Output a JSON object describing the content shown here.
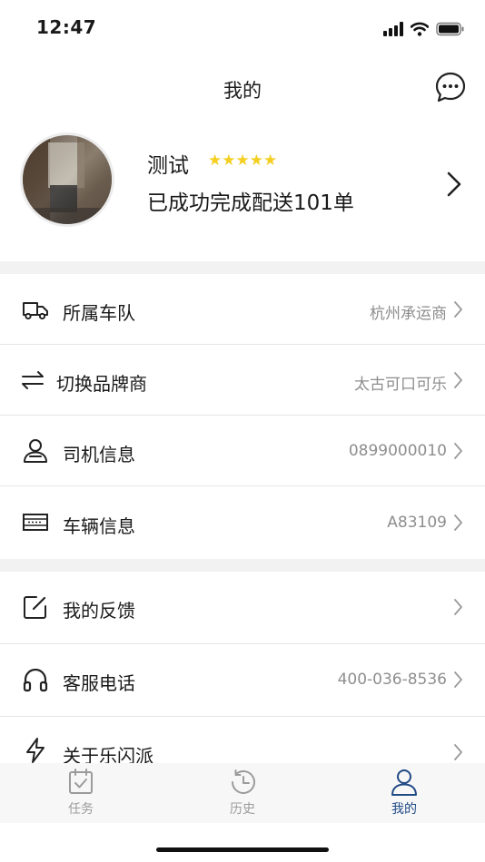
{
  "status_bar": {
    "time": "12:47"
  },
  "header": {
    "title": "我的"
  },
  "profile": {
    "name": "测试",
    "stars": "★★★★★",
    "rating": 5,
    "description": "已成功完成配送101单"
  },
  "menu": {
    "fleet": {
      "label": "所属车队",
      "value": "杭州承运商"
    },
    "brand": {
      "label": "切换品牌商",
      "value": "太古可口可乐"
    },
    "driver": {
      "label": "司机信息",
      "value": "0899000010"
    },
    "vehicle": {
      "label": "车辆信息",
      "value": "A83109"
    },
    "feedback": {
      "label": "我的反馈"
    },
    "service": {
      "label": "客服电话",
      "value": "400-036-8536"
    },
    "about": {
      "label": "关于乐闪派"
    }
  },
  "tabs": {
    "task": {
      "label": "任务"
    },
    "history": {
      "label": "历史"
    },
    "mine": {
      "label": "我的"
    }
  },
  "colors": {
    "accent": "#204a86",
    "star": "#f4cf21",
    "band": "#f2f2f2",
    "muted": "#8e8e8e"
  },
  "icons": [
    "signal-icon",
    "wifi-icon",
    "battery-icon",
    "message-icon",
    "truck-icon",
    "switch-icon",
    "driver-icon",
    "vehicle-card-icon",
    "feedback-icon",
    "headphones-icon",
    "lightning-icon",
    "calendar-check-icon",
    "history-icon",
    "user-icon"
  ]
}
